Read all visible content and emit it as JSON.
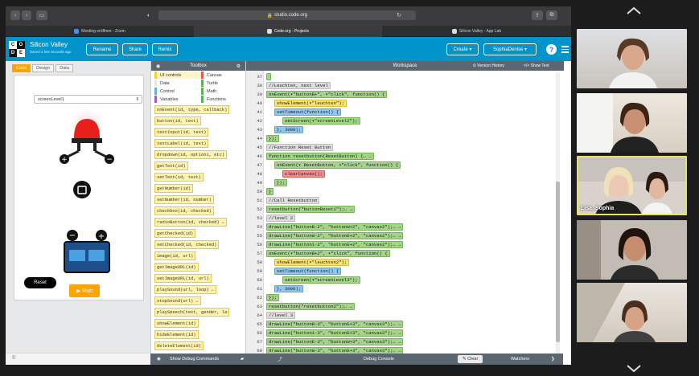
{
  "browser": {
    "url": "studio.code.org",
    "tabs": [
      "Meeting eröffnen - Zoom",
      "Code.org - Projects",
      "Silicon Valley - App Lab"
    ]
  },
  "header": {
    "project_name": "Silicon Valley",
    "project_sub": "Saved a few seconds ago",
    "rename": "Rename",
    "share": "Share",
    "remix": "Remix",
    "create": "Create",
    "user": "SophiaDenise",
    "help": "?"
  },
  "left": {
    "modes": [
      "Code",
      "Design",
      "Data"
    ],
    "screen_select": "screenLevel1",
    "reset": "Reset",
    "run": "Run",
    "copyright": "©"
  },
  "toolbox": {
    "title": "Toolbox",
    "categories": [
      {
        "label": "UI controls",
        "color": "#f5d22f"
      },
      {
        "label": "Canvas",
        "color": "#e05b5b"
      },
      {
        "label": "Data",
        "color": "#e8e8e8"
      },
      {
        "label": "Turtle",
        "color": "#56b35a"
      },
      {
        "label": "Control",
        "color": "#68b0e0"
      },
      {
        "label": "Math",
        "color": "#56b35a"
      },
      {
        "label": "Variables",
        "color": "#a05cc8"
      },
      {
        "label": "Functions",
        "color": "#56b35a"
      }
    ],
    "blocks": [
      "onEvent(id, type, callback)",
      "button(id, text)",
      "textInput(id, text)",
      "textLabel(id, text)",
      "dropdown(id, option1, etc)",
      "getText(id)",
      "setText(id, text)",
      "getNumber(id)",
      "setNumber(id, number)",
      "checkbox(id, checked)",
      "radioButton(id, checked) ←",
      "getChecked(id)",
      "setChecked(id, checked)",
      "image(id, url)",
      "getImageURL(id)",
      "setImageURL(id, url)",
      "playSound(url, loop) ←",
      "stopSound(url) ←",
      "playSpeech(text, gender, la",
      "showElement(id)",
      "hideElement(id)",
      "deleteElement(id)"
    ]
  },
  "workspace": {
    "title": "Workspace",
    "version_history": "Version History",
    "show_text": "</> Show Text",
    "lines": [
      {
        "n": "37",
        "text": "",
        "cls": "g",
        "indent": 0
      },
      {
        "n": "38",
        "text": "//Leuchten, next level",
        "cls": "cm",
        "indent": 0
      },
      {
        "n": "39",
        "text": "onEvent(▾\"buttonB+\", ▾\"click\", function() {",
        "cls": "g",
        "indent": 0
      },
      {
        "n": "40",
        "text": "showElement(▾\"leuchten\");",
        "cls": "y",
        "indent": 1
      },
      {
        "n": "41",
        "text": "setTimeout(function() {",
        "cls": "b",
        "indent": 1
      },
      {
        "n": "42",
        "text": "setScreen(▾\"screenLevel2\");",
        "cls": "g",
        "indent": 2
      },
      {
        "n": "43",
        "text": "}, 3000);",
        "cls": "b",
        "indent": 1
      },
      {
        "n": "44",
        "text": "});",
        "cls": "g",
        "indent": 0
      },
      {
        "n": "45",
        "text": "//Function Reset Button",
        "cls": "cm",
        "indent": 0
      },
      {
        "n": "46",
        "text": "function resetbutton(ResetButton) {← →",
        "cls": "g",
        "indent": 0
      },
      {
        "n": "47",
        "text": "onEvent(▾ ResetButton, ▾\"click\", function() {",
        "cls": "g",
        "indent": 1
      },
      {
        "n": "48",
        "text": "clearCanvas();",
        "cls": "r",
        "indent": 2
      },
      {
        "n": "49",
        "text": "});",
        "cls": "g",
        "indent": 1
      },
      {
        "n": "50",
        "text": "}",
        "cls": "g",
        "indent": 0
      },
      {
        "n": "51",
        "text": "//Call Resetbutton",
        "cls": "cm",
        "indent": 0
      },
      {
        "n": "52",
        "text": "resetbutton(\"buttonReset1\");← →",
        "cls": "g",
        "indent": 0
      },
      {
        "n": "53",
        "text": "//level 2",
        "cls": "cm",
        "indent": 0
      },
      {
        "n": "54",
        "text": "drawLine(\"buttonB-2\", \"buttonW+2\", \"canvas2\");← →",
        "cls": "g",
        "indent": 0
      },
      {
        "n": "55",
        "text": "drawLine(\"buttonW-2\", \"buttonE+2\", \"canvas2\");← →",
        "cls": "g",
        "indent": 0
      },
      {
        "n": "56",
        "text": "drawLine(\"button1-2\", \"buttonE+2\", \"canvas2\");← →",
        "cls": "g",
        "indent": 0
      },
      {
        "n": "57",
        "text": "onEvent(▾\"buttonB+2\", ▾\"click\", function() {",
        "cls": "g",
        "indent": 0
      },
      {
        "n": "58",
        "text": "showElement(▾\"leuchten2\");",
        "cls": "y",
        "indent": 1
      },
      {
        "n": "59",
        "text": "setTimeout(function() {",
        "cls": "b",
        "indent": 1
      },
      {
        "n": "60",
        "text": "setScreen(▾\"screenLevel3\");",
        "cls": "g",
        "indent": 2
      },
      {
        "n": "61",
        "text": "}, 3000);",
        "cls": "b",
        "indent": 1
      },
      {
        "n": "62",
        "text": "});",
        "cls": "g",
        "indent": 0
      },
      {
        "n": "63",
        "text": "resetbutton(\"resetbutton2\");← →",
        "cls": "g",
        "indent": 0
      },
      {
        "n": "64",
        "text": "//level 3",
        "cls": "cm",
        "indent": 0
      },
      {
        "n": "65",
        "text": "drawLine(\"buttonB-3\", \"buttonE+3\", \"canvas3\");← →",
        "cls": "g",
        "indent": 0
      },
      {
        "n": "66",
        "text": "drawLine(\"button1-3\", \"buttonE+3\", \"canvas3\");← →",
        "cls": "g",
        "indent": 0
      },
      {
        "n": "67",
        "text": "drawLine(\"buttonE-3\", \"buttonW+3\", \"canvas3\");← →",
        "cls": "g",
        "indent": 0
      },
      {
        "n": "68",
        "text": "drawLine(\"buttonW-3\", \"buttonE+3\", \"canvas3\");← →",
        "cls": "g",
        "indent": 0
      }
    ]
  },
  "debug": {
    "show_commands": "Show Debug Commands",
    "console": "Debug Console",
    "clear": "Clear",
    "watchers": "Watchers"
  },
  "video": {
    "highlight_name": "Lisa, Sophia",
    "highlight_color": "#e9e26a"
  }
}
